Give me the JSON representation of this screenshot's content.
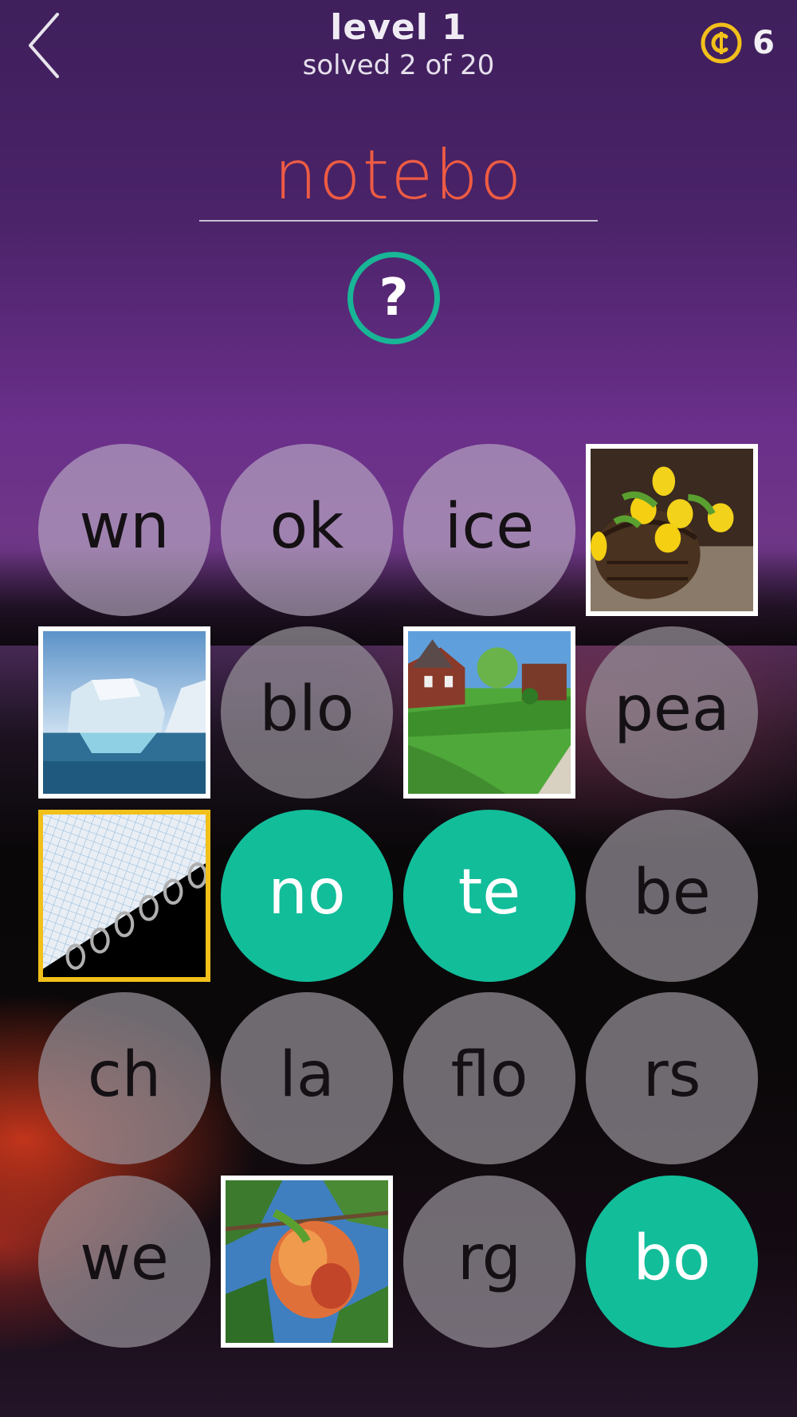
{
  "header": {
    "level_title": "level 1",
    "progress_text": "solved 2 of 20",
    "coin_count": "6"
  },
  "answer": {
    "current": "notebo"
  },
  "colors": {
    "answer_text": "#ee5b43",
    "selected_tile": "#12bd9a",
    "hint_ring": "#18b596",
    "coin": "#f2c01a"
  },
  "tiles": [
    {
      "kind": "syllable",
      "text": "wn",
      "state": "default"
    },
    {
      "kind": "syllable",
      "text": "ok",
      "state": "default"
    },
    {
      "kind": "syllable",
      "text": "ice",
      "state": "default"
    },
    {
      "kind": "photo",
      "subject": "yellow-tulips-in-basket"
    },
    {
      "kind": "photo",
      "subject": "iceberg"
    },
    {
      "kind": "syllable",
      "text": "blo",
      "state": "default"
    },
    {
      "kind": "photo",
      "subject": "brick-house-lawn"
    },
    {
      "kind": "syllable",
      "text": "pea",
      "state": "default"
    },
    {
      "kind": "photo",
      "subject": "spiral-notebook",
      "highlighted": true
    },
    {
      "kind": "syllable",
      "text": "no",
      "state": "selected"
    },
    {
      "kind": "syllable",
      "text": "te",
      "state": "selected"
    },
    {
      "kind": "syllable",
      "text": "be",
      "state": "default"
    },
    {
      "kind": "syllable",
      "text": "ch",
      "state": "default"
    },
    {
      "kind": "syllable",
      "text": "la",
      "state": "default"
    },
    {
      "kind": "syllable",
      "text": "flo",
      "state": "default"
    },
    {
      "kind": "syllable",
      "text": "rs",
      "state": "default"
    },
    {
      "kind": "syllable",
      "text": "we",
      "state": "default"
    },
    {
      "kind": "photo",
      "subject": "peach-on-branch"
    },
    {
      "kind": "syllable",
      "text": "rg",
      "state": "default"
    },
    {
      "kind": "syllable",
      "text": "bo",
      "state": "selected"
    }
  ]
}
